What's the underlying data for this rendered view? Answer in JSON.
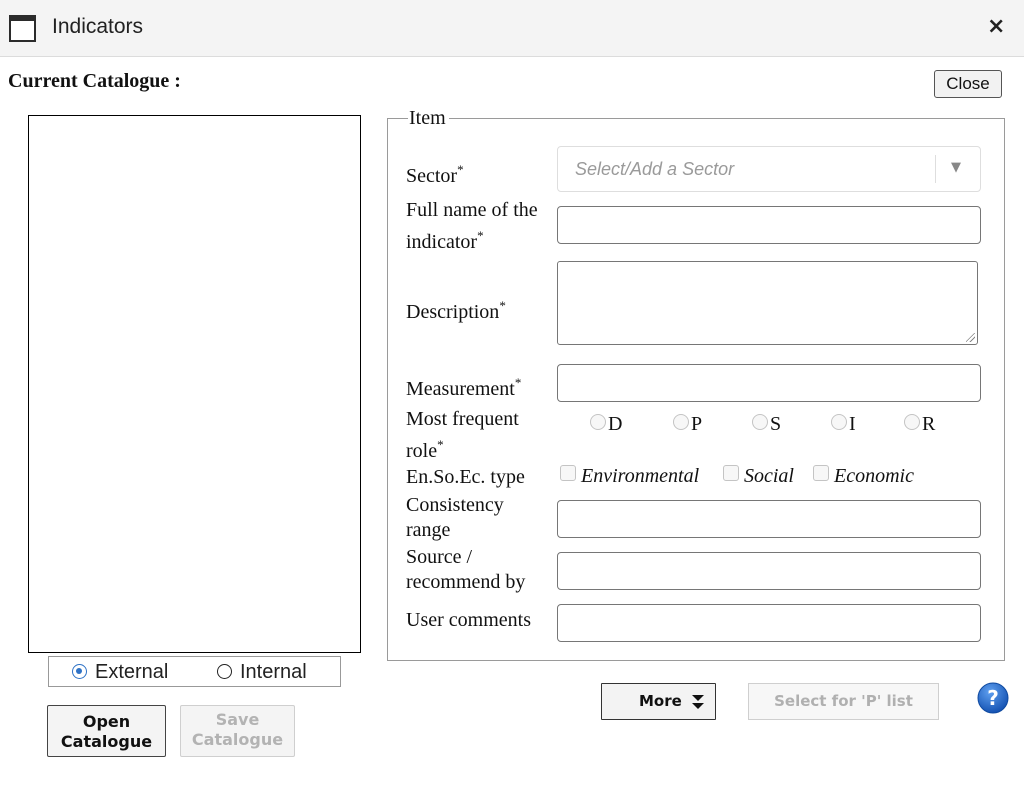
{
  "window": {
    "title": "Indicators",
    "close_glyph": "×"
  },
  "catalogue": {
    "current_label": "Current Catalogue :",
    "close_label": "Close",
    "source_options": [
      {
        "label": "External",
        "selected": true
      },
      {
        "label": "Internal",
        "selected": false
      }
    ],
    "open_label": "Open Catalogue",
    "save_label": "Save Catalogue"
  },
  "item": {
    "legend": "Item",
    "sector": {
      "label": "Sector",
      "placeholder": "Select/Add a Sector",
      "required_mark": "*"
    },
    "full_name": {
      "label": "Full name of the indicator",
      "line1": "Full name of the",
      "line2": "indicator",
      "required_mark": "*",
      "value": ""
    },
    "description": {
      "label": "Description",
      "required_mark": "*",
      "value": ""
    },
    "measurement": {
      "label": "Measurement",
      "required_mark": "*",
      "value": ""
    },
    "role": {
      "label_line1": "Most frequent",
      "label_line2": "role",
      "required_mark": "*",
      "options": [
        "D",
        "P",
        "S",
        "I",
        "R"
      ]
    },
    "ensoec": {
      "label": "En.So.Ec. type",
      "options": [
        "Environmental",
        "Social",
        "Economic"
      ]
    },
    "consistency": {
      "label_line1": "Consistency",
      "label_line2": "range",
      "value": ""
    },
    "source": {
      "label_line1": "Source /",
      "label_line2": "recommend by",
      "value": ""
    },
    "comments": {
      "label": "User comments",
      "value": ""
    }
  },
  "actions": {
    "more_label": "More",
    "select_label": "Select for 'P' list",
    "help_glyph": "?"
  },
  "colors": {
    "accent": "#2e72c6",
    "help": "#1b63c4",
    "disabled_text": "#b0b0b0"
  }
}
